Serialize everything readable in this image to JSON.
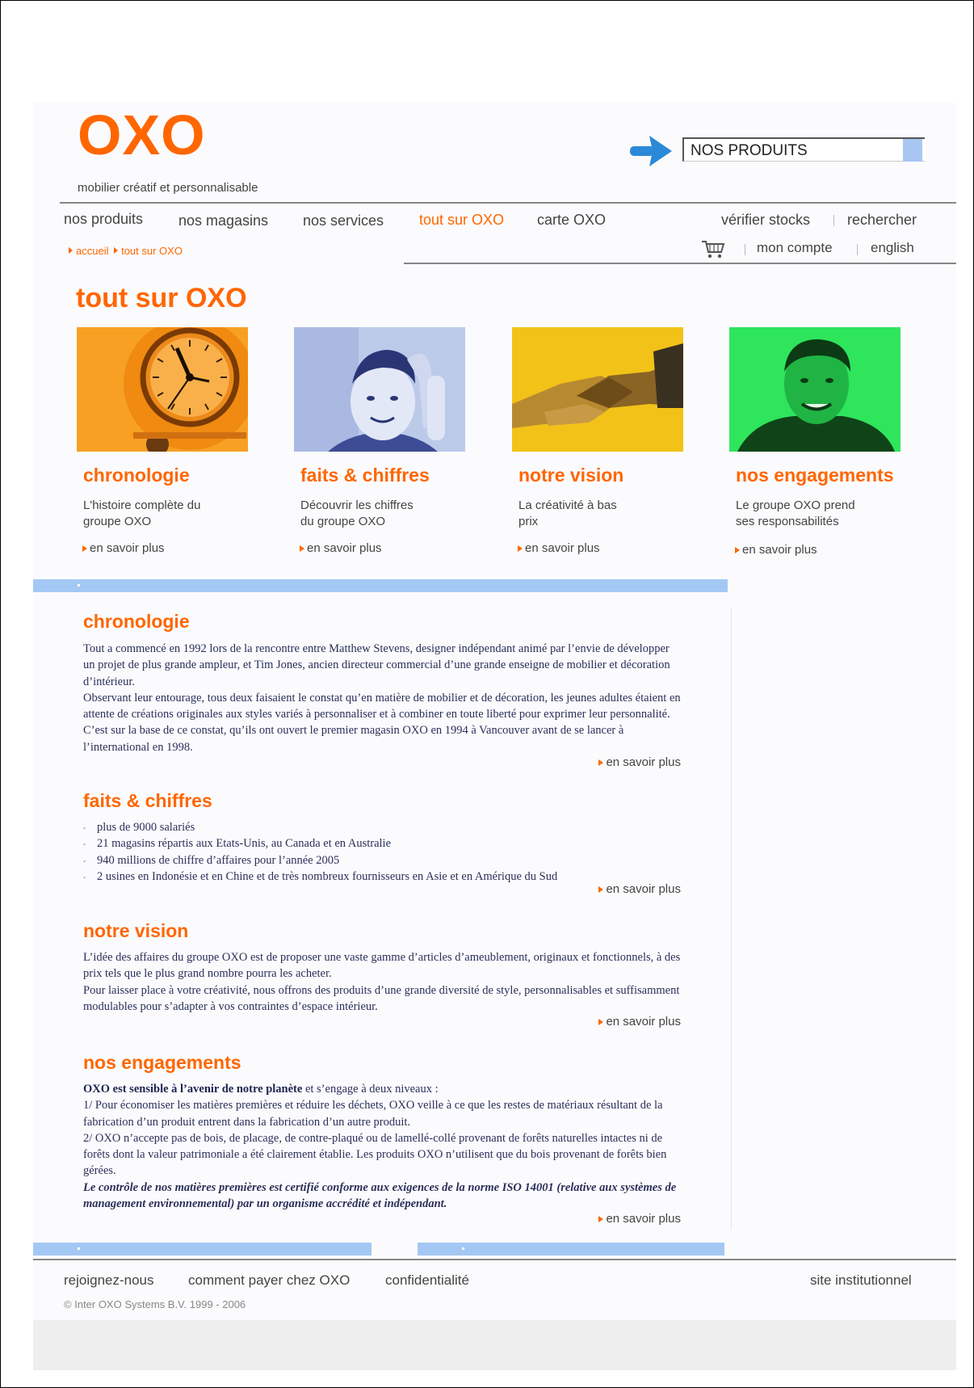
{
  "brand": {
    "logo": "OXO",
    "tagline": "mobilier créatif et personnalisable"
  },
  "search": {
    "label": "NOS PRODUITS"
  },
  "nav": {
    "main": [
      "nos produits",
      "nos magasins",
      "nos services",
      "tout sur OXO",
      "carte OXO"
    ],
    "active": "tout sur OXO",
    "util_top": [
      "vérifier stocks",
      "rechercher"
    ],
    "util_bottom": [
      "mon compte",
      "english"
    ]
  },
  "breadcrumb": [
    "accueil",
    "tout sur OXO"
  ],
  "page_title": "tout sur OXO",
  "cards": [
    {
      "title": "chronologie",
      "desc": "L'histoire complète du groupe OXO",
      "more": "en savoir plus",
      "image": "clock-photo"
    },
    {
      "title": "faits & chiffres",
      "desc": "Découvrir les chiffres du groupe OXO",
      "more": "en savoir plus",
      "image": "child-photo"
    },
    {
      "title": "notre vision",
      "desc": "La créativité à bas prix",
      "more": "en savoir plus",
      "image": "handshake-photo"
    },
    {
      "title": "nos engagements",
      "desc": "Le groupe OXO prend ses responsabilités",
      "more": "en savoir plus",
      "image": "man-portrait-photo"
    }
  ],
  "sections": {
    "chronologie": {
      "title": "chronologie",
      "p1": "Tout a commencé en 1992 lors de la rencontre entre Matthew Stevens, designer indépendant animé par l’envie de développer un projet de plus grande ampleur, et Tim Jones, ancien directeur commercial d’une grande enseigne de mobilier et décoration d’intérieur.",
      "p2": "Observant leur entourage, tous deux faisaient le constat qu’en matière de mobilier et de décoration, les jeunes adultes étaient en attente de créations originales aux styles variés à personnaliser et à combiner en toute liberté pour exprimer leur personnalité. C’est sur la base de ce constat, qu’ils ont ouvert le premier magasin OXO en 1994 à Vancouver avant de se lancer à l’international en 1998.",
      "more": "en savoir plus"
    },
    "faits": {
      "title": "faits & chiffres",
      "items": [
        "plus de 9000 salariés",
        "21 magasins répartis aux Etats-Unis, au Canada et en Australie",
        "940 millions de chiffre d’affaires pour l’année 2005",
        "2 usines en Indonésie et en Chine et de très nombreux fournisseurs en Asie et en Amérique du Sud"
      ],
      "more": "en savoir plus"
    },
    "vision": {
      "title": "notre vision",
      "p1": "L’idée des affaires du groupe OXO est de proposer une vaste gamme d’articles d’ameublement, originaux et fonctionnels, à des prix tels que le plus grand nombre pourra les acheter.",
      "p2": "Pour laisser place à votre créativité, nous offrons des produits d’une grande diversité de style, personnalisables et suffisamment modulables pour s’adapter à vos contraintes d’espace intérieur.",
      "more": "en savoir plus"
    },
    "engagements": {
      "title": "nos engagements",
      "lead_bold": "OXO est sensible à l’avenir de notre planète",
      "lead_rest": " et s’engage à deux niveaux :",
      "p1": "1/ Pour économiser les matières premières et réduire les déchets, OXO veille à ce que les restes de matériaux résultant de la fabrication d’un produit entrent dans la fabrication d’un autre produit.",
      "p2": "2/ OXO n’accepte pas de bois, de placage, de contre-plaqué ou de lamellé-collé provenant de forêts naturelles intactes ni de forêts dont la valeur patrimoniale a été clairement établie. Les produits OXO n’utilisent que du bois provenant de forêts bien gérées.",
      "p3": "Le contrôle de nos matières premières est certifié conforme aux exigences de la norme ISO 14001 (relative aux systèmes de management environnemental) par un organisme accrédité et indépendant.",
      "more": "en savoir plus"
    }
  },
  "footer": {
    "links": [
      "rejoignez-nous",
      "comment payer chez OXO",
      "confidentialité"
    ],
    "right": "site institutionnel",
    "copyright": "© Inter OXO Systems B.V. 1999 - 2006"
  },
  "colors": {
    "accent": "#ff6600",
    "bar": "#a4c8f4",
    "arrow": "#2a8ad8"
  },
  "icons": [
    "arrow-right-icon",
    "cart-icon",
    "triangle-bullet-icon"
  ]
}
